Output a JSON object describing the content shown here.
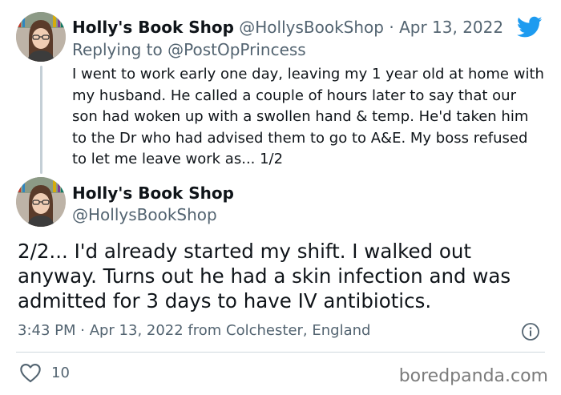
{
  "tweet1": {
    "name": "Holly's Book Shop",
    "handle": "@HollysBookShop",
    "separator": "·",
    "date": "Apr 13, 2022",
    "replying_prefix": "Replying to",
    "replying_to": "@PostOpPrincess",
    "text": "I went to work early one day, leaving my 1 year old at home with my husband. He called a couple of hours later to say that our son had woken up with a swollen hand & temp. He'd taken him to the Dr who had advised them to go to A&E. My boss refused to let me leave work as... 1/2",
    "avatar_icon": "profile-photo"
  },
  "tweet2": {
    "name": "Holly's Book Shop",
    "handle": "@HollysBookShop",
    "text": "2/2... I'd already started my shift. I walked out anyway. Turns out he had a skin infection and was admitted for 3 days to have IV antibiotics.",
    "meta": "3:43 PM · Apr 13, 2022 from Colchester, England",
    "likes": "10",
    "avatar_icon": "profile-photo"
  },
  "icons": {
    "brand": "twitter-bird-icon",
    "info": "info-icon",
    "like": "heart-icon"
  },
  "watermark": "boredpanda.com",
  "colors": {
    "twitter_blue": "#1d9bf0",
    "text": "#0f1419",
    "muted": "#536471",
    "divider": "#cfd9de"
  }
}
